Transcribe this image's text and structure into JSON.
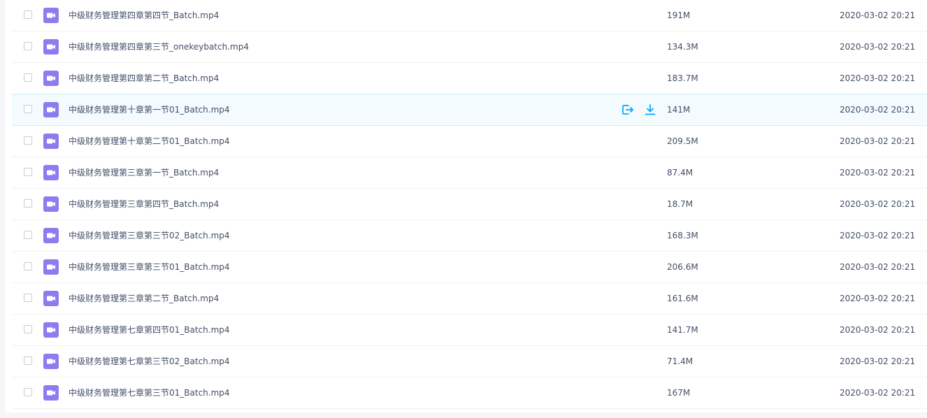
{
  "rows": [
    {
      "name": "中级财务管理第四章第四节_Batch.mp4",
      "size": "191M",
      "date": "2020-03-02 20:21"
    },
    {
      "name": "中级财务管理第四章第三节_onekeybatch.mp4",
      "size": "134.3M",
      "date": "2020-03-02 20:21"
    },
    {
      "name": "中级财务管理第四章第二节_Batch.mp4",
      "size": "183.7M",
      "date": "2020-03-02 20:21"
    },
    {
      "name": "中级财务管理第十章第一节01_Batch.mp4",
      "size": "141M",
      "date": "2020-03-02 20:21",
      "hover": true
    },
    {
      "name": "中级财务管理第十章第二节01_Batch.mp4",
      "size": "209.5M",
      "date": "2020-03-02 20:21"
    },
    {
      "name": "中级财务管理第三章第一节_Batch.mp4",
      "size": "87.4M",
      "date": "2020-03-02 20:21"
    },
    {
      "name": "中级财务管理第三章第四节_Batch.mp4",
      "size": "18.7M",
      "date": "2020-03-02 20:21"
    },
    {
      "name": "中级财务管理第三章第三节02_Batch.mp4",
      "size": "168.3M",
      "date": "2020-03-02 20:21"
    },
    {
      "name": "中级财务管理第三章第三节01_Batch.mp4",
      "size": "206.6M",
      "date": "2020-03-02 20:21"
    },
    {
      "name": "中级财务管理第三章第二节_Batch.mp4",
      "size": "161.6M",
      "date": "2020-03-02 20:21"
    },
    {
      "name": "中级财务管理第七章第四节01_Batch.mp4",
      "size": "141.7M",
      "date": "2020-03-02 20:21"
    },
    {
      "name": "中级财务管理第七章第三节02_Batch.mp4",
      "size": "71.4M",
      "date": "2020-03-02 20:21"
    },
    {
      "name": "中级财务管理第七章第三节01_Batch.mp4",
      "size": "167M",
      "date": "2020-03-02 20:21"
    }
  ],
  "icons": {
    "file": "video-file-icon",
    "share": "share-icon",
    "download": "download-icon"
  },
  "colors": {
    "video_icon": "#8c7cf0",
    "action_icon": "#06a7ff",
    "hover_row": "#f4fbff"
  }
}
